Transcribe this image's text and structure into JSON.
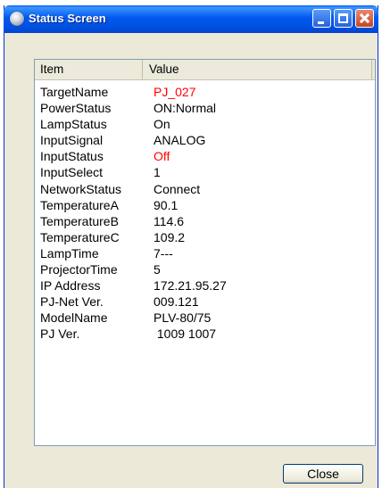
{
  "window": {
    "title": "Status Screen"
  },
  "list": {
    "columns": {
      "item": "Item",
      "value": "Value"
    },
    "rows": [
      {
        "item": "TargetName",
        "value": "PJ_027",
        "color": "#ff0000"
      },
      {
        "item": "PowerStatus",
        "value": "ON:Normal"
      },
      {
        "item": "LampStatus",
        "value": "On"
      },
      {
        "item": "InputSignal",
        "value": "ANALOG"
      },
      {
        "item": "InputStatus",
        "value": "Off",
        "color": "#ff0000"
      },
      {
        "item": "InputSelect",
        "value": "1"
      },
      {
        "item": "NetworkStatus",
        "value": "Connect"
      },
      {
        "item": "TemperatureA",
        "value": "90.1"
      },
      {
        "item": "TemperatureB",
        "value": "114.6"
      },
      {
        "item": "TemperatureC",
        "value": "109.2"
      },
      {
        "item": "LampTime",
        "value": "7---"
      },
      {
        "item": "ProjectorTime",
        "value": "5"
      },
      {
        "item": "IP Address",
        "value": "172.21.95.27"
      },
      {
        "item": "PJ-Net Ver.",
        "value": "009.121"
      },
      {
        "item": "ModelName",
        "value": "PLV-80/75"
      },
      {
        "item": "PJ Ver.",
        "value": " 1009 1007"
      }
    ]
  },
  "buttons": {
    "close": "Close"
  }
}
